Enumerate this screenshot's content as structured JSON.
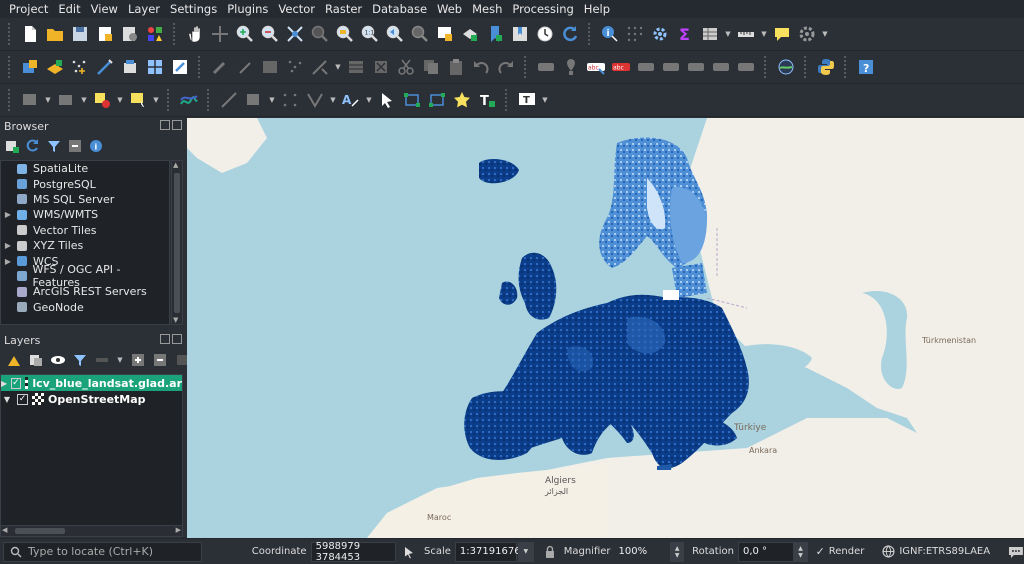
{
  "menu": [
    "Project",
    "Edit",
    "View",
    "Layer",
    "Settings",
    "Plugins",
    "Vector",
    "Raster",
    "Database",
    "Web",
    "Mesh",
    "Processing",
    "Help"
  ],
  "browser": {
    "title": "Browser",
    "items": [
      {
        "label": "SpatiaLite",
        "expandable": false
      },
      {
        "label": "PostgreSQL",
        "expandable": false
      },
      {
        "label": "MS SQL Server",
        "expandable": false
      },
      {
        "label": "WMS/WMTS",
        "expandable": true
      },
      {
        "label": "Vector Tiles",
        "expandable": false
      },
      {
        "label": "XYZ Tiles",
        "expandable": true
      },
      {
        "label": "WCS",
        "expandable": true
      },
      {
        "label": "WFS / OGC API - Features",
        "expandable": false
      },
      {
        "label": "ArcGIS REST Servers",
        "expandable": false
      },
      {
        "label": "GeoNode",
        "expandable": false
      }
    ]
  },
  "layers": {
    "title": "Layers",
    "items": [
      {
        "label": "lcv_blue_landsat.glad.ar",
        "checked": true,
        "selected": true
      },
      {
        "label": "OpenStreetMap",
        "checked": true,
        "selected": false
      }
    ]
  },
  "map_labels": {
    "algiers": "Algiers",
    "algiers_ar": "الجزائر",
    "ankara": "Ankara",
    "ankara_tr": "Türkiye",
    "maroc": "Maroc",
    "turkmenistan": "Türkmenistan"
  },
  "status": {
    "locator_placeholder": "Type to locate (Ctrl+K)",
    "coordinate_label": "Coordinate",
    "coordinate_value": "5988979 3784453",
    "scale_label": "Scale",
    "scale_value": "1:37191676",
    "magnifier_label": "Magnifier",
    "magnifier_value": "100%",
    "rotation_label": "Rotation",
    "rotation_value": "0,0 °",
    "render_label": "Render",
    "render_checked": true,
    "crs": "IGNF:ETRS89LAEA"
  }
}
